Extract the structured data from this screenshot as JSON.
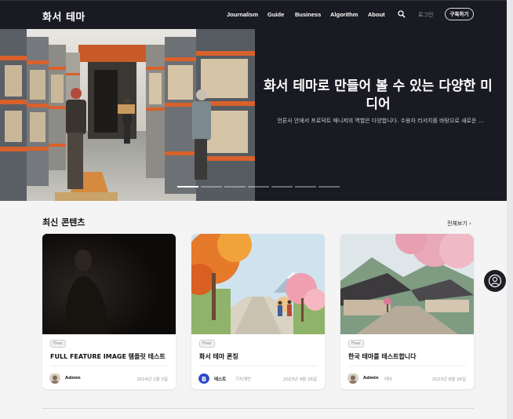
{
  "header": {
    "logo": "화서 테마",
    "nav": [
      "Journalism",
      "Guide",
      "Business",
      "Algorithm",
      "About"
    ],
    "search_icon": "search-icon",
    "login": "로그인",
    "subscribe": "구독하기"
  },
  "hero": {
    "title": "화서 테마로 만들어 볼 수 있는 다양한 미디어",
    "subtitle": "언론사 안에서 프로덕트 매니저의 역할은 다양합니다. 수용자 리서치를 바탕으로 새로운 …",
    "slide_count": 7,
    "active_slide": 1
  },
  "section": {
    "title": "최신 콘텐츠",
    "more": "전체보기"
  },
  "cards": [
    {
      "badge": "Free",
      "title": "FULL FEATURE IMAGE 템플릿 테스트",
      "author": "Admin",
      "category": "",
      "date": "2024년 1월 3일"
    },
    {
      "badge": "Free",
      "title": "화서 테마 론칭",
      "author": "테스트",
      "category": "기치계안",
      "date": "2023년 9월 26일"
    },
    {
      "badge": "Free",
      "title": "한국 테마를 테스트합니다",
      "author": "Admin",
      "category": "테마",
      "date": "2023년 8월 26일"
    }
  ],
  "colors": {
    "header_bg": "#191a22",
    "hero_bg": "#191a22",
    "page_bg": "#f4f4f5"
  },
  "fab_icon": "user-circle-icon"
}
